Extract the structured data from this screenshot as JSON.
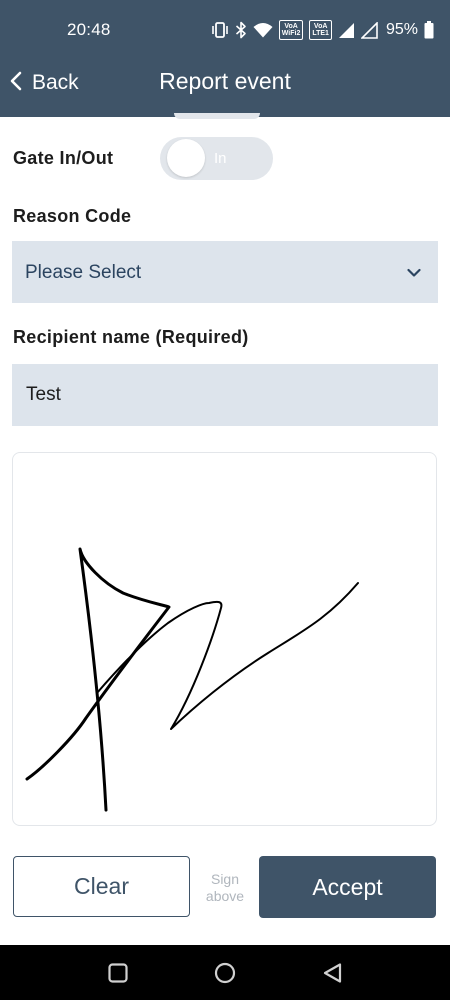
{
  "status_bar": {
    "time": "20:48",
    "battery_percent": "95%",
    "chip_volte_wifi": [
      "VoA",
      "WiFi2"
    ],
    "chip_volte_lte": [
      "VoA",
      "LTE1"
    ],
    "icons": [
      "vibrate-icon",
      "bluetooth-icon",
      "wifi-icon",
      "signal-icon",
      "signal-roaming-icon",
      "battery-icon"
    ]
  },
  "header": {
    "back_label": "Back",
    "title": "Report event",
    "background_color": "#3f5468"
  },
  "form": {
    "gate_label": "Gate In/Out",
    "gate_toggle_text": "In",
    "gate_toggle_on": false,
    "reason_label": "Reason Code",
    "reason_value": "Please Select",
    "recipient_label": "Recipient name (Required)",
    "recipient_value": "Test"
  },
  "signature": {
    "hint_line1": "Sign",
    "hint_line2": "above"
  },
  "actions": {
    "clear_label": "Clear",
    "accept_label": "Accept"
  },
  "nav_bar": {
    "buttons": [
      "recents-icon",
      "home-icon",
      "back-triangle-icon"
    ]
  },
  "colors": {
    "primary": "#3f5468",
    "field_background": "#dde4ec",
    "select_text": "#2b4460"
  }
}
